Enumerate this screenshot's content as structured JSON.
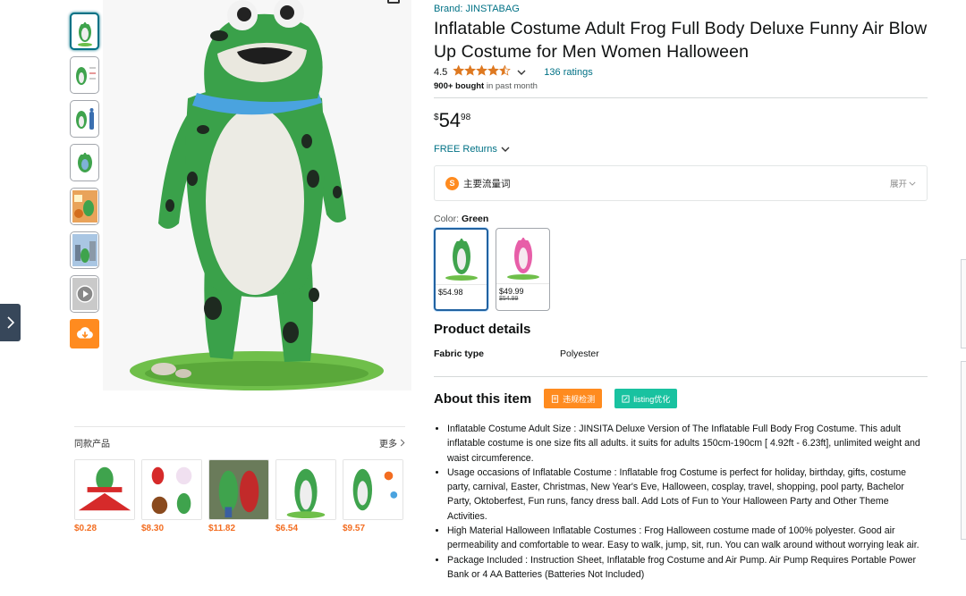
{
  "brand": "Brand: JINSTABAG",
  "title": "Inflatable Costume Adult Frog Full Body Deluxe Funny Air Blow Up Costume for Men Women Halloween",
  "rating": {
    "value": "4.5",
    "stars": 4.5,
    "count_text": "136 ratings"
  },
  "bought": {
    "bold": "900+ bought",
    "rest": " in past month"
  },
  "price": {
    "symbol": "$",
    "whole": "54",
    "fraction": "98"
  },
  "returns": "FREE Returns",
  "keyword_panel": {
    "label": "主要流量词",
    "expand": "展开",
    "logo": "S"
  },
  "color": {
    "label": "Color: ",
    "selected": "Green"
  },
  "swatches": [
    {
      "name": "Green",
      "price": "$54.98",
      "old_price": "",
      "color": "#3fa34d"
    },
    {
      "name": "Pink",
      "price": "$49.99",
      "old_price": "$54.99",
      "color": "#e75ea8"
    }
  ],
  "product_details": {
    "title": "Product details",
    "rows": [
      {
        "key": "Fabric type",
        "value": "Polyester"
      }
    ]
  },
  "about": {
    "title": "About this item",
    "btn_violation": "违规检测",
    "btn_listing": "listing优化",
    "bullets": [
      "Inflatable Costume Adult Size : JINSITA Deluxe Version of The Inflatable Full Body Frog Costume. This adult inflatable costume is one size fits all adults. it suits for adults 150cm-190cm [ 4.92ft - 6.23ft], unlimited weight and waist circumference.",
      "Usage occasions of Inflatable Costume : Inflatable frog Costume is perfect for holiday, birthday, gifts, costume party, carnival, Easter, Christmas, New Year's Eve, Halloween, cosplay, travel, shopping, pool party, Bachelor Party, Oktoberfest, Fun runs, fancy dress ball. Add Lots of Fun to Your Halloween Party and Other Theme Activities.",
      "High Material Halloween Inflatable Costumes : Frog Halloween costume made of 100% polyester. Good air permeability and comfortable to wear. Easy to walk, jump, sit, run. You can walk around without worrying leak air.",
      "Package Included : Instruction Sheet, Inflatable frog Costume and Air Pump. Air Pump Requires Portable Power Bank or 4 AA Batteries (Batteries Not Included)"
    ]
  },
  "similar": {
    "title": "同款产品",
    "more": "更多",
    "items": [
      {
        "price": "$0.28"
      },
      {
        "price": "$8.30"
      },
      {
        "price": "$11.82"
      },
      {
        "price": "$6.54"
      },
      {
        "price": "$9.57"
      }
    ]
  },
  "thumbnails": [
    "frog-front",
    "frog-size-chart",
    "frog-dimensions",
    "frog-model",
    "frog-party",
    "frog-scene",
    "frog-video"
  ],
  "colors": {
    "link": "#007185",
    "star": "#de7921",
    "accent_orange": "#ff8b1f",
    "accent_teal": "#19c2a0",
    "similar_price": "#f36d21"
  }
}
